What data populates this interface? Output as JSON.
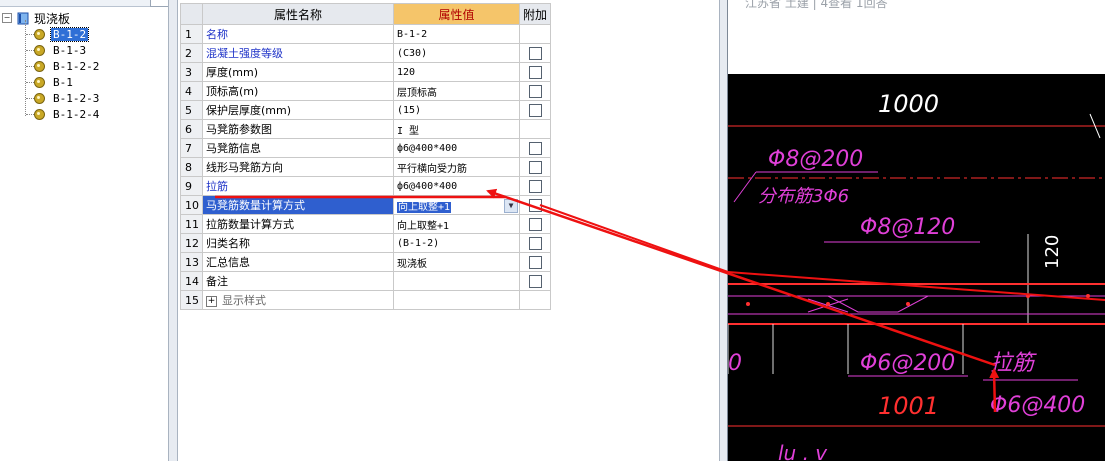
{
  "tree": {
    "root_label": "现浇板",
    "items": [
      {
        "label": "B-1-2",
        "selected": true
      },
      {
        "label": "B-1-3",
        "selected": false
      },
      {
        "label": "B-1-2-2",
        "selected": false
      },
      {
        "label": "B-1",
        "selected": false
      },
      {
        "label": "B-1-2-3",
        "selected": false
      },
      {
        "label": "B-1-2-4",
        "selected": false
      }
    ]
  },
  "grid": {
    "headers": {
      "name": "属性名称",
      "value": "属性值",
      "extra": "附加"
    },
    "rows": [
      {
        "num": "1",
        "name": "名称",
        "value": "B-1-2",
        "checkbox": false
      },
      {
        "num": "2",
        "name": "混凝土强度等级",
        "value": "(C30)",
        "checkbox": true
      },
      {
        "num": "3",
        "name": "厚度(mm)",
        "value": "120",
        "checkbox": true
      },
      {
        "num": "4",
        "name": "顶标高(m)",
        "value": "层顶标高",
        "checkbox": true
      },
      {
        "num": "5",
        "name": "保护层厚度(mm)",
        "value": "(15)",
        "checkbox": true
      },
      {
        "num": "6",
        "name": "马凳筋参数图",
        "value": "I 型",
        "checkbox": false
      },
      {
        "num": "7",
        "name": "马凳筋信息",
        "value": "ф6@400*400",
        "checkbox": true
      },
      {
        "num": "8",
        "name": "线形马凳筋方向",
        "value": "平行横向受力筋",
        "checkbox": true
      },
      {
        "num": "9",
        "name": "拉筋",
        "value": "ф6@400*400",
        "checkbox": true
      },
      {
        "num": "10",
        "name": "马凳筋数量计算方式",
        "value": "向上取整+1",
        "checkbox": true
      },
      {
        "num": "11",
        "name": "拉筋数量计算方式",
        "value": "向上取整+1",
        "checkbox": true
      },
      {
        "num": "12",
        "name": "归类名称",
        "value": "(B-1-2)",
        "checkbox": true
      },
      {
        "num": "13",
        "name": "汇总信息",
        "value": "现浇板",
        "checkbox": true
      },
      {
        "num": "14",
        "name": "备注",
        "value": "",
        "checkbox": true
      },
      {
        "num": "15",
        "name": "显示样式",
        "value": "",
        "checkbox": false
      }
    ],
    "expand_symbol": "+"
  },
  "right_top": {
    "text": "江苏省 土建    |    4查看 1回答"
  },
  "cad": {
    "dim_top": "1000",
    "label_phi8_200": "Φ8@200",
    "label_distribution": "分布筋3Φ6",
    "label_phi8_120": "Φ8@120",
    "dim_side": "120",
    "label_zero": "0",
    "label_phi6_200": "Φ6@200",
    "label_lajin": "拉筋",
    "dim_bottom": "1001",
    "label_phi6_400": "Φ6@400",
    "label_bottom_partial": "lu  . v"
  },
  "colors": {
    "accent_header": "#f5c56a",
    "selection_blue": "#2f5fcf",
    "name_blue": "#1f33c8",
    "cad_magenta": "#e040d8",
    "cad_red": "#ff3030",
    "annotation_red": "#ee1111"
  }
}
